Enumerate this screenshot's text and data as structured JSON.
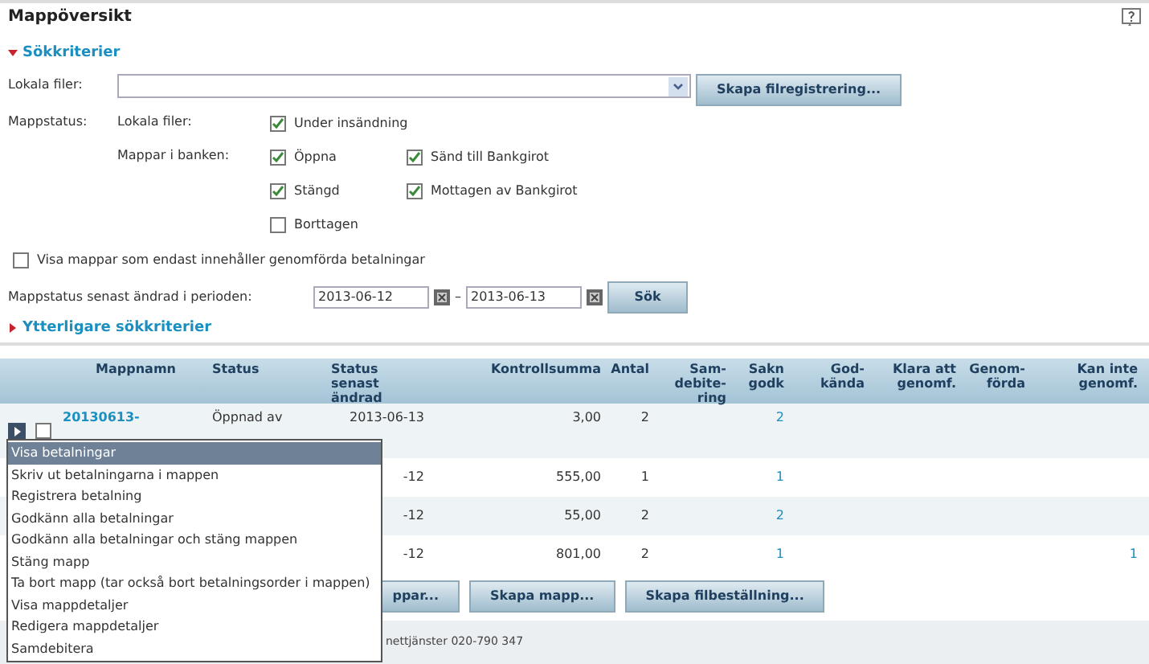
{
  "title": "Mappöversikt",
  "search": {
    "heading": "Sökkriterier",
    "expanded": true
  },
  "local_files": {
    "label": "Lokala filer:",
    "button": "Skapa filregistrering..."
  },
  "mappstatus": {
    "label": "Mappstatus:",
    "groups": [
      {
        "label": "Lokala filer:",
        "options": [
          {
            "label": "Under insändning",
            "checked": true
          }
        ]
      },
      {
        "label": "Mappar i banken:",
        "options": [
          {
            "label": "Öppna",
            "checked": true
          },
          {
            "label": "Sänd till Bankgirot",
            "checked": true
          },
          {
            "label": "Stängd",
            "checked": true
          },
          {
            "label": "Mottagen av Bankgirot",
            "checked": true
          },
          {
            "label": "Borttagen",
            "checked": false
          }
        ]
      }
    ]
  },
  "only_completed": {
    "label": "Visa mappar som endast innehåller genomförda betalningar",
    "checked": false
  },
  "period": {
    "label": "Mappstatus senast ändrad i perioden:",
    "from": "2013-06-12",
    "separator": "–",
    "to": "2013-06-13",
    "button": "Sök"
  },
  "more_criteria": {
    "label": "Ytterligare sökkriterier",
    "expanded": false
  },
  "table": {
    "columns": [
      "Mappnamn",
      "Status",
      "Status senast ändrad",
      "Kontrollsumma",
      "Antal",
      "Sam-debite-ring",
      "Sakn godk",
      "God-kända",
      "Klara att genomf.",
      "Genom-förda",
      "Kan inte genomf."
    ],
    "rows": [
      {
        "cells": [
          "20130613-",
          "Öppnad av",
          "2013-06-13",
          "3,00",
          "2",
          "",
          "2",
          "",
          "",
          "",
          ""
        ],
        "checked": false
      },
      {
        "cells": [
          "",
          "",
          "-12",
          "555,00",
          "1",
          "",
          "1",
          "",
          "",
          "",
          ""
        ]
      },
      {
        "cells": [
          "",
          "",
          "-12",
          "55,00",
          "2",
          "",
          "2",
          "",
          "",
          "",
          ""
        ]
      },
      {
        "cells": [
          "",
          "",
          "-12",
          "801,00",
          "2",
          "",
          "1",
          "",
          "",
          "",
          "1"
        ]
      }
    ]
  },
  "menu": {
    "items": [
      {
        "label": "Visa betalningar",
        "selected": true
      },
      {
        "label": "Skriv ut betalningarna i mappen",
        "selected": false
      },
      {
        "label": "Registrera betalning",
        "selected": false
      },
      {
        "label": "Godkänn alla betalningar",
        "selected": false
      },
      {
        "label": "Godkänn alla betalningar och stäng mappen",
        "selected": false
      },
      {
        "label": "Stäng mapp",
        "selected": false
      },
      {
        "label": "Ta bort mapp (tar också bort betalningsorder i mappen)",
        "selected": false
      },
      {
        "label": "Visa mappdetaljer",
        "selected": false
      },
      {
        "label": "Redigera mappdetaljer",
        "selected": false
      },
      {
        "label": "Samdebitera",
        "selected": false
      }
    ]
  },
  "buttons": [
    "ppar...",
    "Skapa mapp...",
    "Skapa filbeställning..."
  ],
  "footer": "nettjänster 020-790 347"
}
